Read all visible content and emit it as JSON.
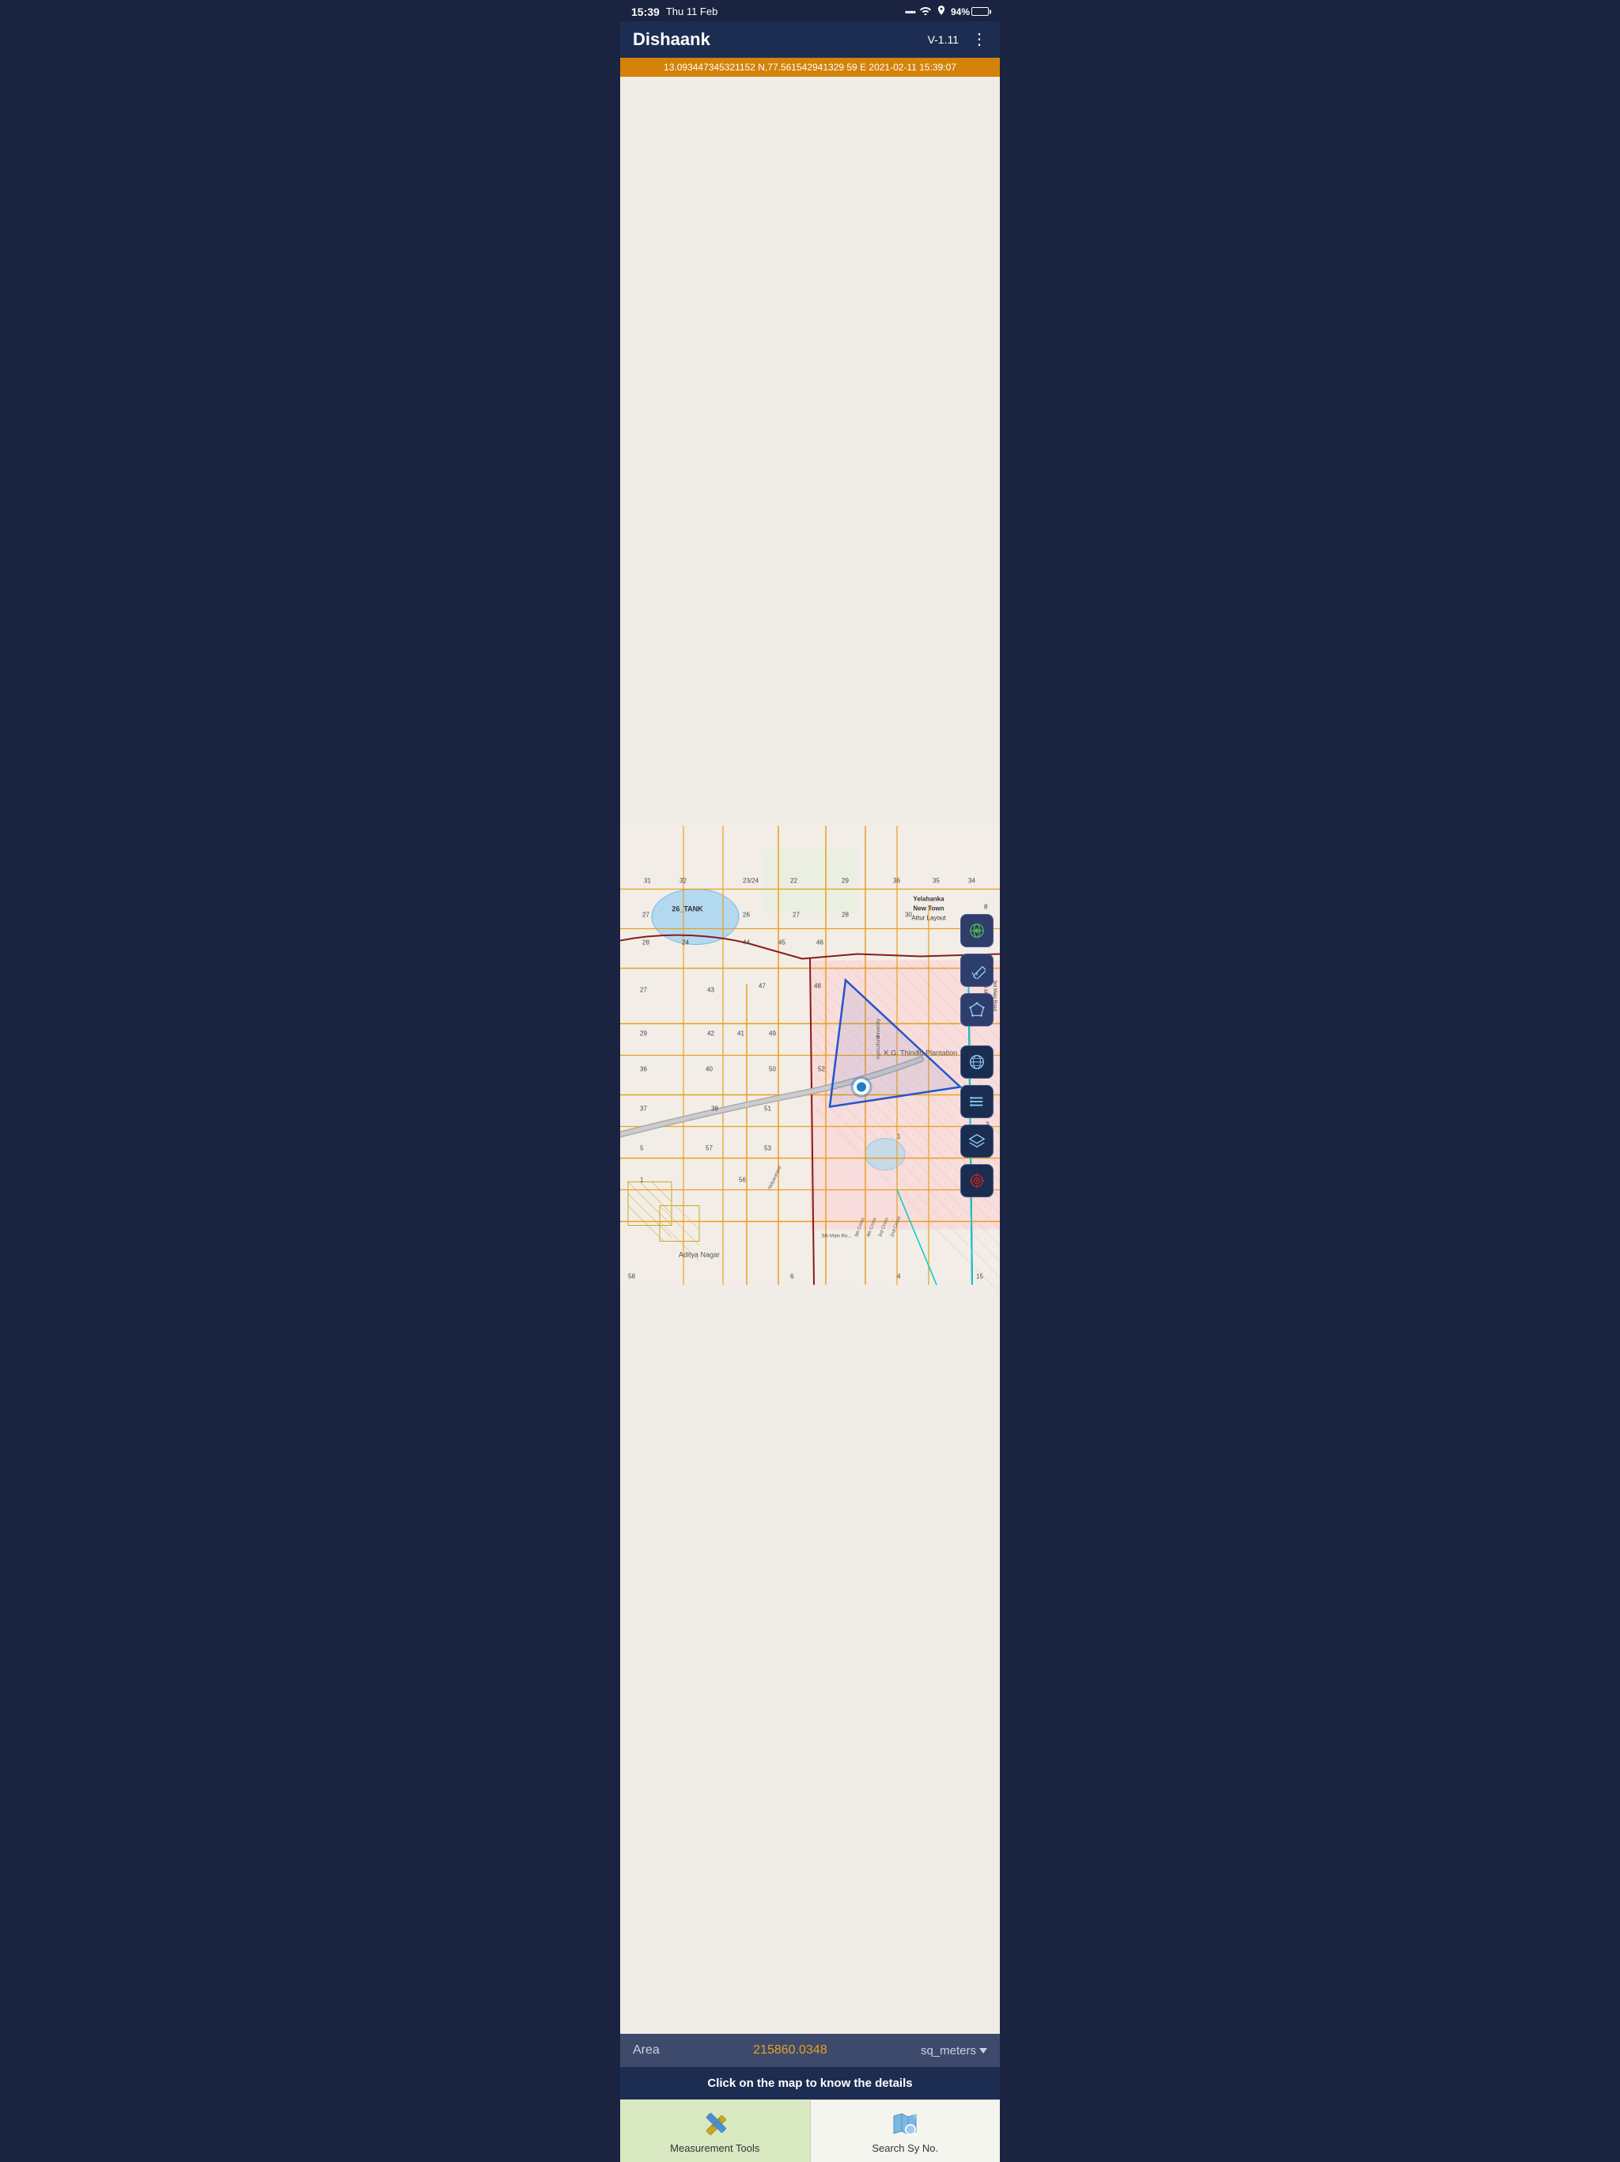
{
  "status_bar": {
    "time": "15:39",
    "date": "Thu 11 Feb",
    "battery_pct": "94%",
    "signal": "●●●",
    "wifi": "WiFi",
    "gps": "GPS"
  },
  "header": {
    "title": "Dishaank",
    "version": "V-1.11",
    "menu_icon": "⋮"
  },
  "coords_bar": {
    "text": "13.093447345321152 N,77.561542941329 59 E   2021-02-11 15:39:07"
  },
  "map": {
    "location_name": "K.G. Thindlu Plantation",
    "tank_label": "26_TANK",
    "area_label": "Yelahanka New Town Attur Layout",
    "aditya_nagar": "Aditya Nagar"
  },
  "tools": [
    {
      "id": "locate",
      "icon": "locate"
    },
    {
      "id": "measure",
      "icon": "measure"
    },
    {
      "id": "polygon",
      "icon": "polygon"
    }
  ],
  "side_tools": [
    {
      "id": "globe",
      "icon": "globe"
    },
    {
      "id": "list",
      "icon": "list"
    },
    {
      "id": "layers",
      "icon": "layers"
    },
    {
      "id": "target",
      "icon": "target"
    }
  ],
  "area_bar": {
    "label": "Area",
    "value": "215860.0348",
    "unit": "sq_meters",
    "dropdown_icon": "▼"
  },
  "info_bar": {
    "text": "Click on the map to know the details"
  },
  "bottom_nav": {
    "tabs": [
      {
        "id": "measurement-tools",
        "label": "Measurement Tools",
        "active": true
      },
      {
        "id": "search-sy-no",
        "label": "Search Sy No.",
        "active": false
      }
    ]
  }
}
